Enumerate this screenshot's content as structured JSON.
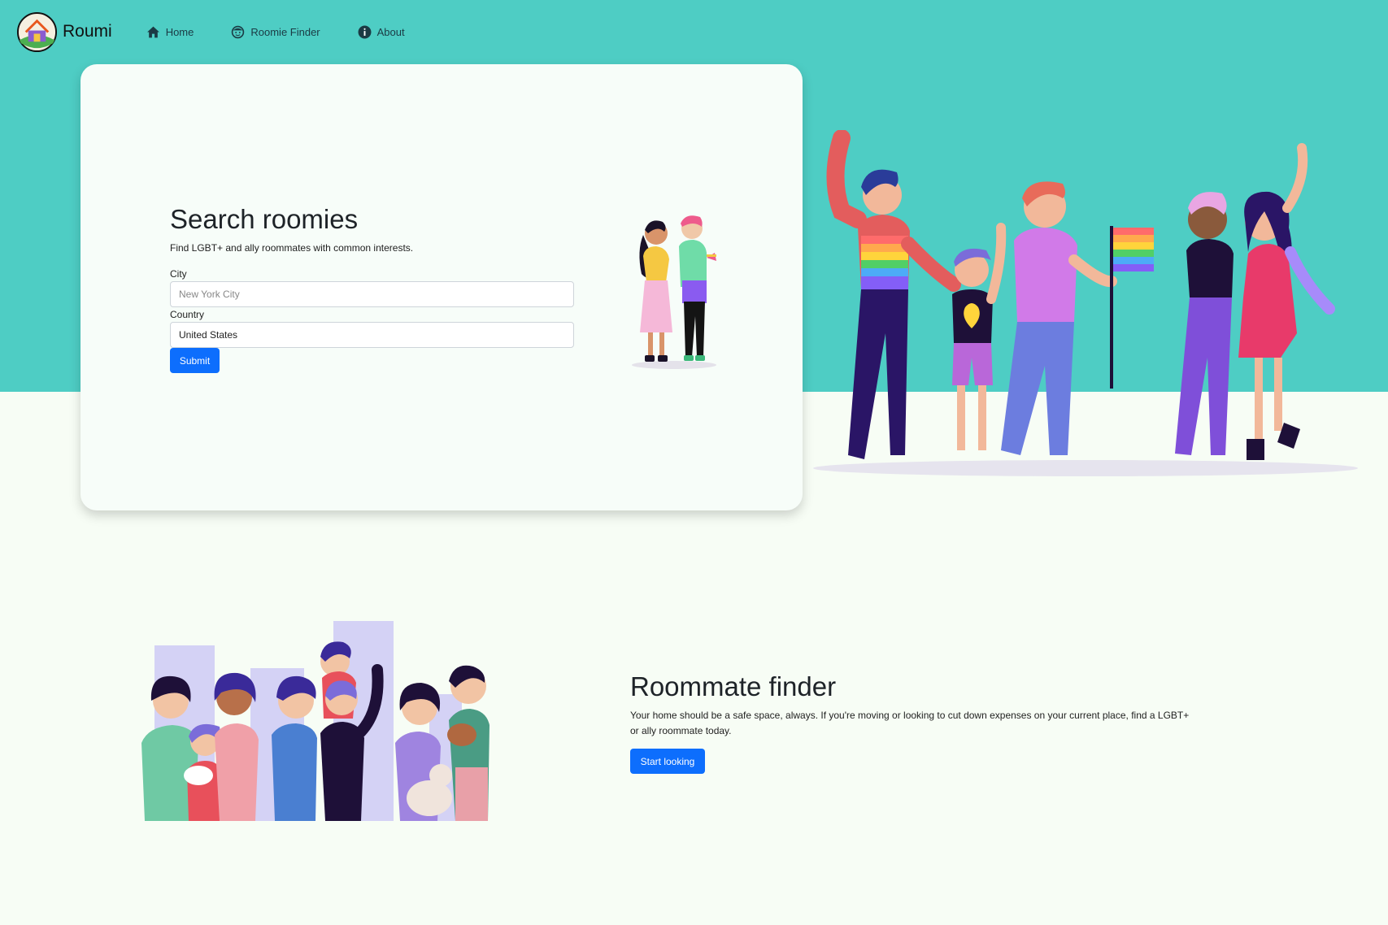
{
  "brand": {
    "name": "Roumi"
  },
  "nav": {
    "items": [
      {
        "label": "Home",
        "icon": "home-icon"
      },
      {
        "label": "Roomie Finder",
        "icon": "face-icon"
      },
      {
        "label": "About",
        "icon": "info-icon"
      }
    ]
  },
  "search": {
    "title": "Search roomies",
    "subtitle": "Find LGBT+ and ally roommates with common interests.",
    "city_label": "City",
    "city_placeholder": "New York City",
    "country_label": "Country",
    "country_value": "United States",
    "submit_label": "Submit"
  },
  "finder": {
    "title": "Roommate finder",
    "text": "Your home should be a safe space, always. If you're moving or looking to cut down expenses on your current place, find a LGBT+ or ally roommate today.",
    "button_label": "Start looking"
  },
  "colors": {
    "teal": "#4ecdc4",
    "background": "#f7fdf5",
    "primary": "#0d6efd"
  }
}
